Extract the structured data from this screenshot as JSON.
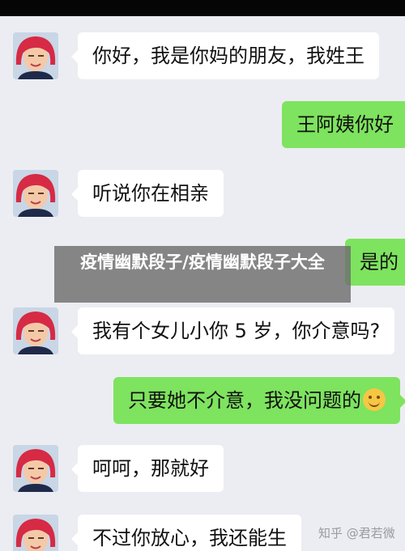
{
  "messages": [
    {
      "side": "left",
      "text": "你好，我是你妈的朋友，我姓王"
    },
    {
      "side": "right",
      "text": "王阿姨你好"
    },
    {
      "side": "left",
      "text": "听说你在相亲"
    },
    {
      "side": "right",
      "text": "是的"
    },
    {
      "side": "left",
      "text": "我有个女儿小你 5 岁，你介意吗?"
    },
    {
      "side": "right",
      "text": "只要她不介意，我没问题的",
      "emoji": "smiling-face-icon"
    },
    {
      "side": "left",
      "text": "呵呵，那就好"
    },
    {
      "side": "left",
      "text": "不过你放心，我还能生"
    }
  ],
  "overlay_title": "疫情幽默段子/疫情幽默段子大全",
  "watermark": "知乎 @君若微",
  "colors": {
    "background": "#ecedf2",
    "sent_bubble": "#7ee35f",
    "received_bubble": "#ffffff",
    "top_bar": "#050505"
  }
}
